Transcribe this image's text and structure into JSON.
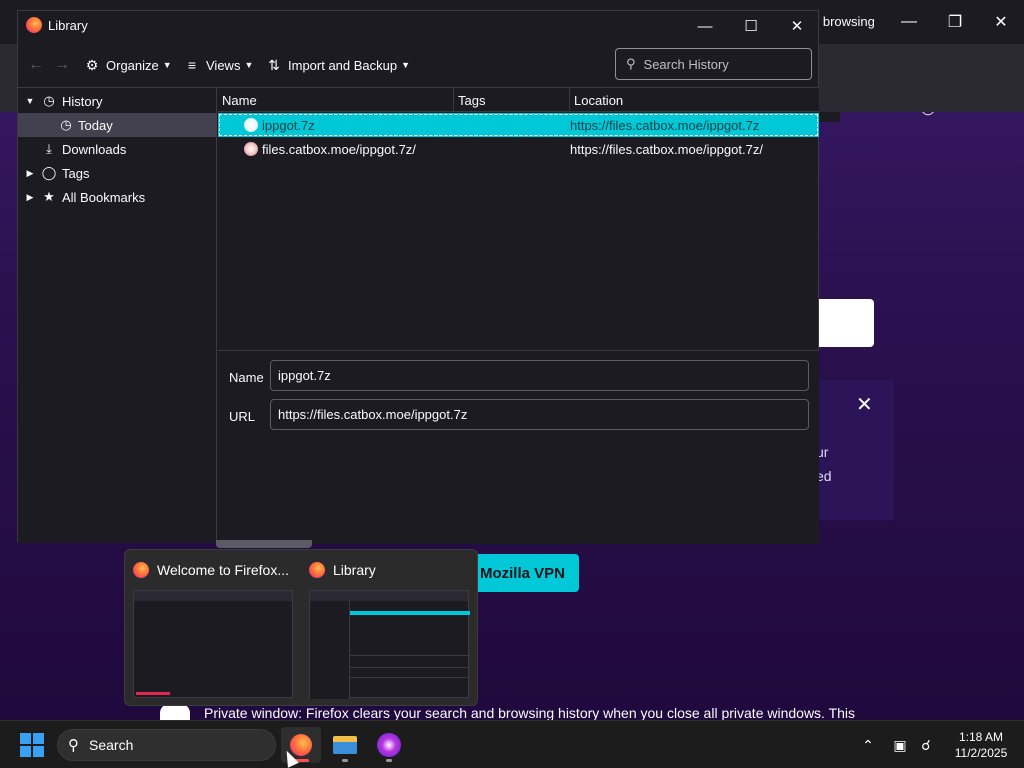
{
  "background_window": {
    "tab_text": "e browsing",
    "vpn_button": "Mozilla VPN",
    "card_text_1": "ur",
    "card_text_2": "ed",
    "private_notice": "Private window: Firefox clears your search and browsing history when you close all private windows. This"
  },
  "library": {
    "title": "Library",
    "toolbar": {
      "organize": "Organize",
      "views": "Views",
      "import_backup": "Import and Backup",
      "search_placeholder": "Search History"
    },
    "sidebar": {
      "items": [
        {
          "label": "History",
          "icon": "clock-icon",
          "expanded": true
        },
        {
          "label": "Today",
          "icon": "clock-icon",
          "selected": true
        },
        {
          "label": "Downloads",
          "icon": "download-icon"
        },
        {
          "label": "Tags",
          "icon": "tag-icon",
          "expanded": false
        },
        {
          "label": "All Bookmarks",
          "icon": "star-icon",
          "expanded": false
        }
      ]
    },
    "columns": [
      "Name",
      "Tags",
      "Location"
    ],
    "rows": [
      {
        "name": "ippgot.7z",
        "tags": "",
        "location": "https://files.catbox.moe/ippgot.7z",
        "selected": true
      },
      {
        "name": "files.catbox.moe/ippgot.7z/",
        "tags": "",
        "location": "https://files.catbox.moe/ippgot.7z/",
        "selected": false
      }
    ],
    "details": {
      "name_label": "Name",
      "name_value": "ippgot.7z",
      "url_label": "URL",
      "url_value": "https://files.catbox.moe/ippgot.7z"
    }
  },
  "taskbar_preview": {
    "items": [
      {
        "title": "Welcome to Firefox..."
      },
      {
        "title": "Library"
      }
    ]
  },
  "taskbar": {
    "search_label": "Search",
    "time": "1:18 AM",
    "date": "11/2/2025"
  },
  "colors": {
    "accent": "#00c8d7",
    "private_purple": "#2b1150",
    "window_bg": "#1c1b22"
  }
}
